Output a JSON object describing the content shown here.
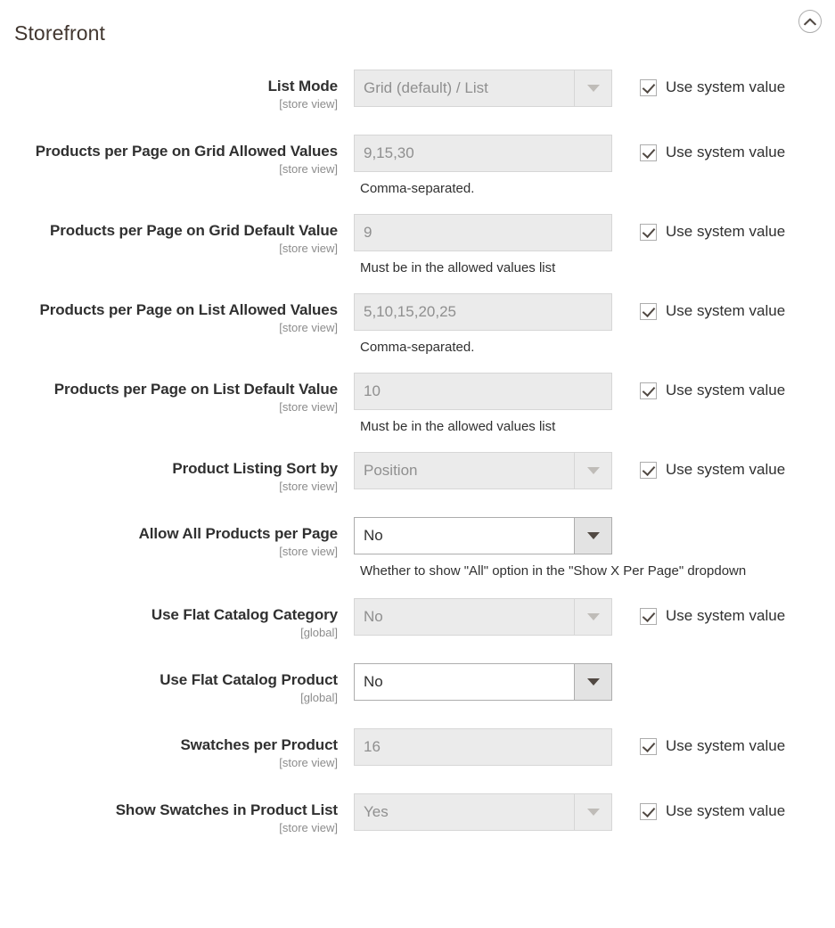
{
  "section": {
    "title": "Storefront",
    "collapse_icon": "chevron-up-icon"
  },
  "inherit": {
    "label": "Use system value"
  },
  "fields": [
    {
      "label": "List Mode",
      "scope": "[store view]",
      "type": "select",
      "value": "Grid (default) / List",
      "disabled": true,
      "note": "",
      "inherit_checked": true,
      "show_inherit": true
    },
    {
      "label": "Products per Page on Grid Allowed Values",
      "scope": "[store view]",
      "type": "text",
      "value": "9,15,30",
      "disabled": true,
      "note": "Comma-separated.",
      "inherit_checked": true,
      "show_inherit": true
    },
    {
      "label": "Products per Page on Grid Default Value",
      "scope": "[store view]",
      "type": "text",
      "value": "9",
      "disabled": true,
      "note": "Must be in the allowed values list",
      "inherit_checked": true,
      "show_inherit": true
    },
    {
      "label": "Products per Page on List Allowed Values",
      "scope": "[store view]",
      "type": "text",
      "value": "5,10,15,20,25",
      "disabled": true,
      "note": "Comma-separated.",
      "inherit_checked": true,
      "show_inherit": true
    },
    {
      "label": "Products per Page on List Default Value",
      "scope": "[store view]",
      "type": "text",
      "value": "10",
      "disabled": true,
      "note": "Must be in the allowed values list",
      "inherit_checked": true,
      "show_inherit": true
    },
    {
      "label": "Product Listing Sort by",
      "scope": "[store view]",
      "type": "select",
      "value": "Position",
      "disabled": true,
      "note": "",
      "inherit_checked": true,
      "show_inherit": true
    },
    {
      "label": "Allow All Products per Page",
      "scope": "[store view]",
      "type": "select",
      "value": "No",
      "disabled": false,
      "note": "Whether to show \"All\" option in the \"Show X Per Page\" dropdown",
      "inherit_checked": false,
      "show_inherit": false
    },
    {
      "label": "Use Flat Catalog Category",
      "scope": "[global]",
      "type": "select",
      "value": "No",
      "disabled": true,
      "note": "",
      "inherit_checked": true,
      "show_inherit": true
    },
    {
      "label": "Use Flat Catalog Product",
      "scope": "[global]",
      "type": "select",
      "value": "No",
      "disabled": false,
      "note": "",
      "inherit_checked": false,
      "show_inherit": false
    },
    {
      "label": "Swatches per Product",
      "scope": "[store view]",
      "type": "text",
      "value": "16",
      "disabled": true,
      "note": "",
      "inherit_checked": true,
      "show_inherit": true
    },
    {
      "label": "Show Swatches in Product List",
      "scope": "[store view]",
      "type": "select",
      "value": "Yes",
      "disabled": true,
      "note": "",
      "inherit_checked": true,
      "show_inherit": true
    }
  ]
}
